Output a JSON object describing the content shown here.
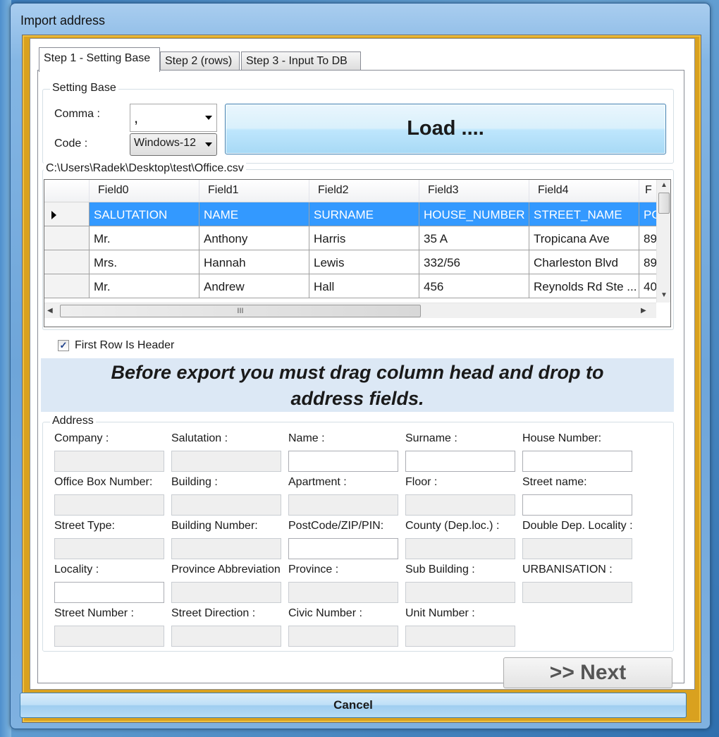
{
  "window": {
    "title": "Import address"
  },
  "tabs": [
    {
      "label": "Step 1 - Setting Base",
      "active": true
    },
    {
      "label": "Step 2 (rows)",
      "active": false
    },
    {
      "label": "Step 3 - Input To DB",
      "active": false
    }
  ],
  "setting_base": {
    "group_label": "Setting Base",
    "comma_label": "Comma :",
    "comma_value": ",",
    "code_label": "Code :",
    "code_value": "Windows-12",
    "load_label": "Load ...."
  },
  "file": {
    "path": "C:\\Users\\Radek\\Desktop\\test\\Office.csv"
  },
  "grid": {
    "columns": [
      "Field0",
      "Field1",
      "Field2",
      "Field3",
      "Field4",
      "F"
    ],
    "rows": [
      [
        "SALUTATION",
        "NAME",
        "SURNAME",
        "HOUSE_NUMBER",
        "STREET_NAME",
        "PO"
      ],
      [
        "Mr.",
        "Anthony",
        "Harris",
        "35 A",
        "Tropicana Ave",
        "89"
      ],
      [
        "Mrs.",
        "Hannah",
        "Lewis",
        "332/56",
        "Charleston Blvd",
        "89"
      ],
      [
        "Mr.",
        "Andrew",
        "Hall",
        "456",
        "Reynolds Rd Ste ...",
        "40"
      ]
    ],
    "selected_row": 0,
    "hscroll_grip": "III"
  },
  "first_row_header": {
    "label": "First Row Is Header",
    "checked": true,
    "check_mark": "✓"
  },
  "banner": {
    "line1": "Before export you must drag column head and drop to",
    "line2": "address fields."
  },
  "address": {
    "group_label": "Address",
    "fields": [
      {
        "label": "Company :",
        "enabled": false
      },
      {
        "label": "Salutation :",
        "enabled": false
      },
      {
        "label": "Name :",
        "enabled": true
      },
      {
        "label": "Surname :",
        "enabled": true
      },
      {
        "label": "House Number:",
        "enabled": true
      },
      {
        "label": "Office Box Number:",
        "enabled": false
      },
      {
        "label": "Building :",
        "enabled": false
      },
      {
        "label": "Apartment :",
        "enabled": false
      },
      {
        "label": "Floor :",
        "enabled": false
      },
      {
        "label": "Street name:",
        "enabled": true
      },
      {
        "label": "Street Type:",
        "enabled": false
      },
      {
        "label": "Building Number:",
        "enabled": false
      },
      {
        "label": "PostCode/ZIP/PIN:",
        "enabled": true
      },
      {
        "label": "County (Dep.loc.) :",
        "enabled": false
      },
      {
        "label": "Double Dep. Locality :",
        "enabled": false
      },
      {
        "label": "Locality :",
        "enabled": true
      },
      {
        "label": "Province Abbreviation",
        "enabled": false
      },
      {
        "label": "Province :",
        "enabled": false
      },
      {
        "label": "Sub Building :",
        "enabled": false
      },
      {
        "label": "URBANISATION :",
        "enabled": false
      },
      {
        "label": "Street Number :",
        "enabled": false
      },
      {
        "label": "Street Direction :",
        "enabled": false
      },
      {
        "label": "Civic Number :",
        "enabled": false
      },
      {
        "label": "Unit Number :",
        "enabled": false
      }
    ]
  },
  "buttons": {
    "next": ">> Next",
    "cancel": "Cancel"
  }
}
